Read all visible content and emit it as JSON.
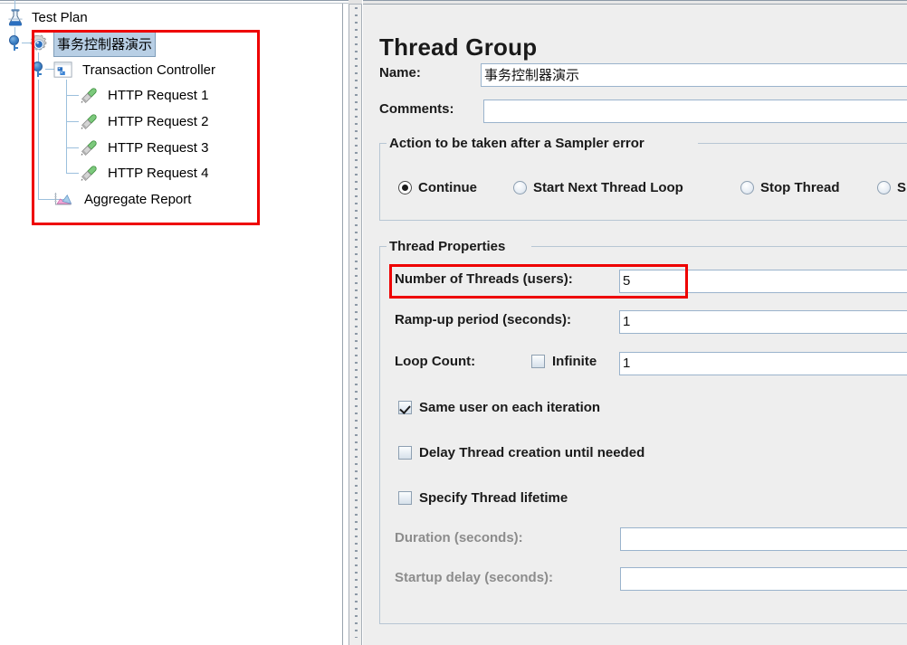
{
  "tree": {
    "nodes": [
      {
        "label": "Test Plan",
        "icon": "test-plan-flask-icon",
        "selected": false
      },
      {
        "label": "事务控制器演示",
        "icon": "thread-group-gear-icon",
        "selected": true
      },
      {
        "label": "Transaction Controller",
        "icon": "transaction-controller-icon",
        "selected": false
      },
      {
        "label": "HTTP Request 1",
        "icon": "http-request-pipette-icon",
        "selected": false
      },
      {
        "label": "HTTP Request 2",
        "icon": "http-request-pipette-icon",
        "selected": false
      },
      {
        "label": "HTTP Request 3",
        "icon": "http-request-pipette-icon",
        "selected": false
      },
      {
        "label": "HTTP Request 4",
        "icon": "http-request-pipette-icon",
        "selected": false
      },
      {
        "label": "Aggregate Report",
        "icon": "aggregate-report-chart-icon",
        "selected": false
      }
    ]
  },
  "annotations": {
    "color": "#ee0000",
    "boxes": [
      "tree-subtree-highlight",
      "number-of-threads-highlight"
    ]
  },
  "panel": {
    "title": "Thread Group",
    "name_label": "Name:",
    "name_value": "事务控制器演示",
    "comments_label": "Comments:",
    "comments_value": "",
    "sampler_error": {
      "legend": "Action to be taken after a Sampler error",
      "options": [
        {
          "label": "Continue",
          "checked": true
        },
        {
          "label": "Start Next Thread Loop",
          "checked": false
        },
        {
          "label": "Stop Thread",
          "checked": false
        },
        {
          "label": "S",
          "checked": false
        }
      ]
    },
    "thread_properties": {
      "legend": "Thread Properties",
      "num_threads_label": "Number of Threads (users):",
      "num_threads_value": "5",
      "rampup_label": "Ramp-up period (seconds):",
      "rampup_value": "1",
      "loop_count_label": "Loop Count:",
      "infinite_label": "Infinite",
      "infinite_checked": false,
      "loop_count_value": "1",
      "same_user_label": "Same user on each iteration",
      "same_user_checked": true,
      "delay_thread_label": "Delay Thread creation until needed",
      "delay_thread_checked": false,
      "specify_lifetime_label": "Specify Thread lifetime",
      "specify_lifetime_checked": false,
      "duration_label": "Duration (seconds):",
      "duration_value": "",
      "startup_delay_label": "Startup delay (seconds):",
      "startup_delay_value": ""
    }
  }
}
